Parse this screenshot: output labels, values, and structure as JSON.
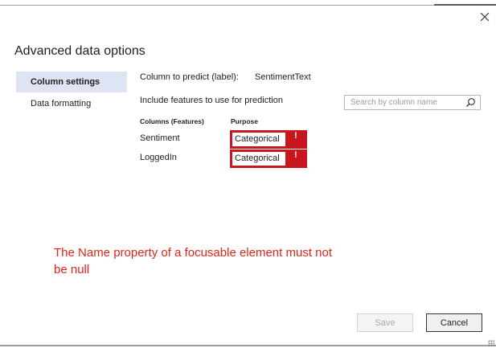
{
  "dialog": {
    "title": "Advanced data options",
    "close_icon": "close-icon"
  },
  "nav": {
    "items": [
      {
        "label": "Column settings",
        "selected": true
      },
      {
        "label": "Data formatting",
        "selected": false
      }
    ]
  },
  "column_settings": {
    "label_caption": "Column to predict (label):",
    "label_value": "SentimentText",
    "include_caption": "Include features to use for prediction",
    "search": {
      "placeholder": "Search by column name",
      "value": "",
      "icon": "search-icon"
    },
    "table": {
      "headers": {
        "columns": "Columns (Features)",
        "purpose": "Purpose"
      },
      "rows": [
        {
          "column": "Sentiment",
          "purpose": "Categorical",
          "error_mark": "!"
        },
        {
          "column": "LoggedIn",
          "purpose": "Categorical",
          "error_mark": "!"
        }
      ]
    }
  },
  "annotation": {
    "text": "The Name property of a focusable element must not be null",
    "color": "#e0241a"
  },
  "footer": {
    "save_label": "Save",
    "save_enabled": false,
    "cancel_label": "Cancel"
  },
  "colors": {
    "nav_selected_bg": "#dfe4f4",
    "error_outline": "#c8161e"
  }
}
